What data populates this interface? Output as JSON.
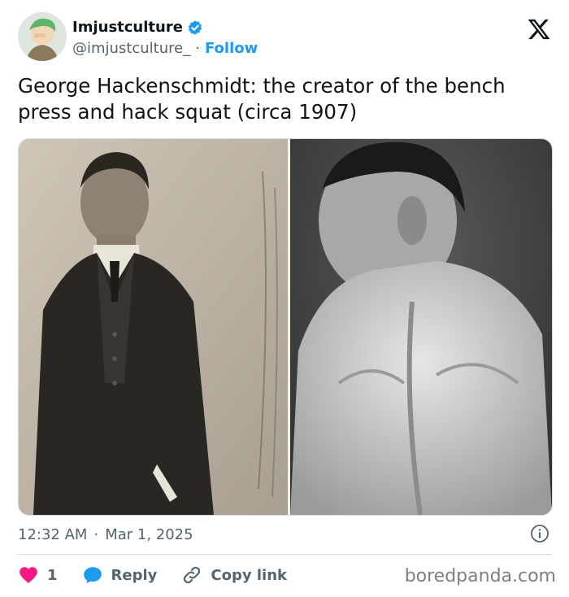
{
  "author": {
    "name": "Imjustculture",
    "handle": "@imjustculture_",
    "separator": "·",
    "follow_label": "Follow",
    "verified": true
  },
  "tweet": {
    "text": "George Hackenschmidt: the creator of the bench press and hack squat (circa 1907)"
  },
  "meta": {
    "time": "12:32 AM",
    "separator": "·",
    "date": "Mar 1, 2025"
  },
  "actions": {
    "like_count": "1",
    "reply_label": "Reply",
    "copy_link_label": "Copy link"
  },
  "watermark": "boredpanda.com",
  "colors": {
    "accent": "#1d9bf0",
    "like": "#f91880",
    "text": "#0f1419",
    "muted": "#536471"
  }
}
